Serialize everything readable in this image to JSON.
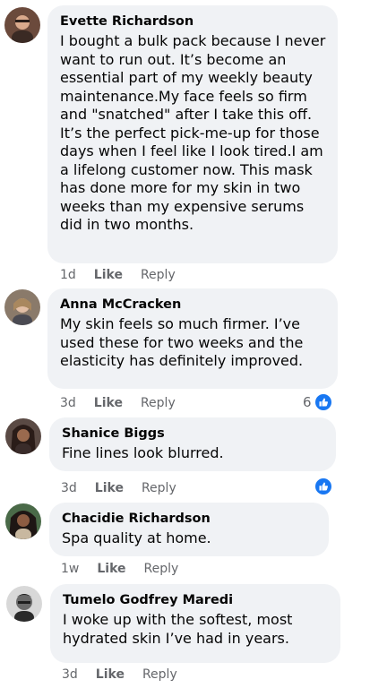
{
  "comments": [
    {
      "author": "Evette Richardson",
      "text": "I bought a bulk pack because I never want to run out. It’s become an essential part of my weekly beauty maintenance.My face feels so firm and \"snatched\" after I take this off. It’s the perfect pick-me-up for those days when I feel like I look tired.I am a lifelong customer now. This mask has done more for my skin in two weeks than my expensive serums did in two months.",
      "time": "1d",
      "like": "Like",
      "reply": "Reply"
    },
    {
      "author": "Anna McCracken",
      "text": "My skin feels so much firmer. I’ve used these for two weeks and the elasticity has definitely improved.",
      "time": "3d",
      "like": "Like",
      "reply": "Reply",
      "reaction_count": "6"
    },
    {
      "author": "Shanice Biggs",
      "text": "Fine lines look blurred.",
      "time": "3d",
      "like": "Like",
      "reply": "Reply"
    },
    {
      "author": "Chacidie Richardson",
      "text": "Spa quality at home.",
      "time": "1w",
      "like": "Like",
      "reply": "Reply"
    },
    {
      "author": "Tumelo Godfrey Maredi",
      "text": "I woke up with the softest, most hydrated skin I’ve had in years.",
      "time": "3d",
      "like": "Like",
      "reply": "Reply"
    }
  ],
  "colors": {
    "bubble": "#f0f2f5",
    "meta": "#65676b",
    "like_badge": "#1877f2"
  },
  "icons": {
    "reaction": "thumbs-up-icon"
  }
}
